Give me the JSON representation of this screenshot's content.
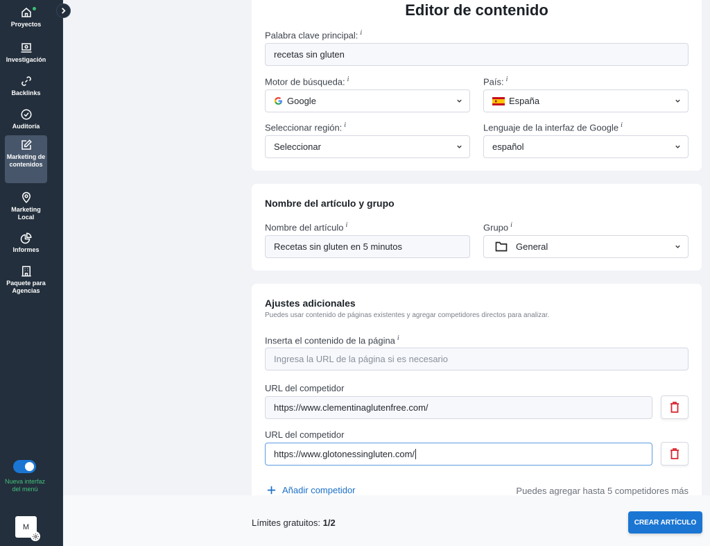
{
  "sidebar": {
    "items": [
      {
        "label": "Proyectos",
        "icon": "home-icon"
      },
      {
        "label": "Investigación",
        "icon": "laptop-search-icon"
      },
      {
        "label": "Backlinks",
        "icon": "link-icon"
      },
      {
        "label": "Auditoría",
        "icon": "check-circle-icon"
      },
      {
        "label": "Marketing de contenidos",
        "icon": "edit-icon",
        "active": true
      },
      {
        "label": "Marketing Local",
        "icon": "map-pin-icon"
      },
      {
        "label": "Informes",
        "icon": "pie-chart-icon"
      },
      {
        "label": "Paquete para Agencias",
        "icon": "building-icon"
      }
    ],
    "toggle_label": "Nueva interfaz del menú",
    "toggle_on": true,
    "avatar_initial": "M"
  },
  "page": {
    "title": "Editor de contenido"
  },
  "keyword": {
    "label": "Palabra clave principal:",
    "value": "recetas sin gluten"
  },
  "engine": {
    "label": "Motor de búsqueda:",
    "value": "Google"
  },
  "country": {
    "label": "País:",
    "value": "España"
  },
  "region": {
    "label": "Seleccionar región:",
    "value": "Seleccionar"
  },
  "language": {
    "label": "Lenguaje de la interfaz de Google",
    "value": "español"
  },
  "article_section": {
    "title": "Nombre del artículo y grupo",
    "name_label": "Nombre del artículo",
    "name_value": "Recetas sin gluten en 5 minutos",
    "group_label": "Grupo",
    "group_value": "General"
  },
  "additional": {
    "title": "Ajustes adicionales",
    "subtitle": "Puedes usar contenido de páginas existentes y agregar competidores directos para analizar.",
    "page_content_label": "Inserta el contenido de la página",
    "page_content_placeholder": "Ingresa la URL de la página si es necesario",
    "competitors": [
      {
        "label": "URL del competidor",
        "value": "https://www.clementinaglutenfree.com/"
      },
      {
        "label": "URL del competidor",
        "value": "https://www.glotonessingluten.com/"
      }
    ],
    "add_competitor": "Añadir competidor",
    "add_hint": "Puedes agregar hasta 5 competidores más"
  },
  "footer": {
    "limits_label": "Límites gratuitos:",
    "limits_value": "1/2",
    "create_button": "CREAR ARTÍCULO"
  },
  "colors": {
    "sidebar_bg": "#232f3c",
    "accent": "#1b76d3",
    "danger": "#d9262f",
    "toggle_label": "#44c07c"
  }
}
